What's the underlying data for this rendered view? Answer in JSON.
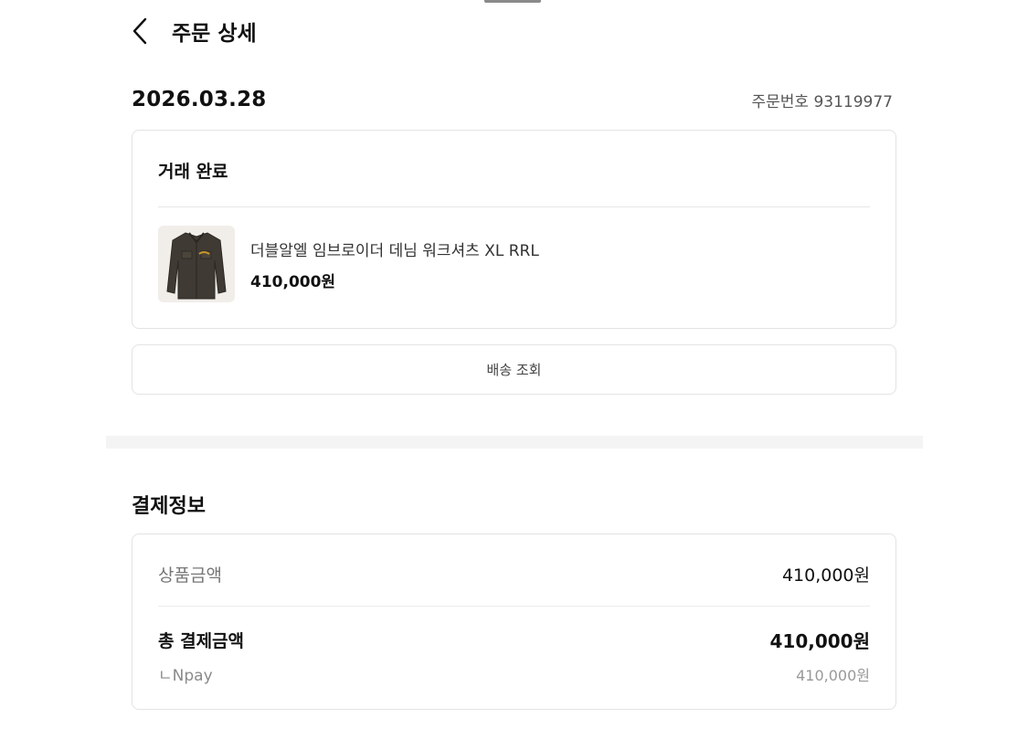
{
  "header": {
    "title": "주문 상세",
    "back_icon": "chevron-left-icon"
  },
  "order": {
    "date": "2026.03.28",
    "number_label": "주문번호 93119977",
    "status": "거래 완료",
    "product": {
      "name": "더블알엘 임브로이더 데님 워크셔츠 XL RRL",
      "price": "410,000원"
    },
    "tracking_button": "배송 조회"
  },
  "payment": {
    "title": "결제정보",
    "goods_label": "상품금액",
    "goods_value": "410,000원",
    "total_label": "총 결제금액",
    "total_value": "410,000원",
    "method_label": "ㄴNpay",
    "method_value": "410,000원"
  },
  "colors": {
    "text_primary": "#111111",
    "text_secondary": "#777777",
    "border": "#e3e3e3",
    "section_divider": "#f4f4f4"
  }
}
